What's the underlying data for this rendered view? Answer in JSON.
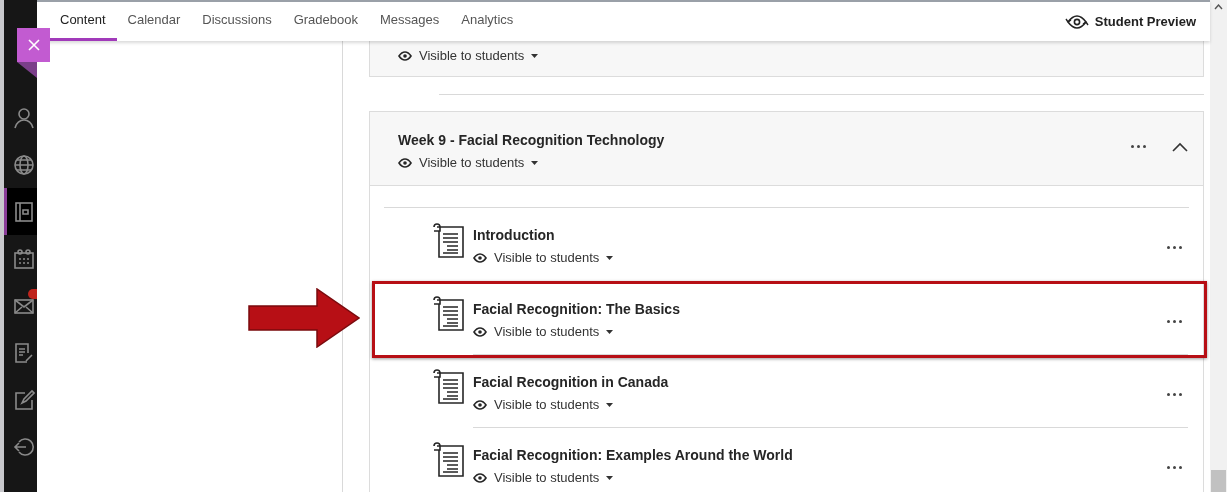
{
  "sidebar": {
    "items": [
      {
        "kind": "profile",
        "selected": false
      },
      {
        "kind": "globe",
        "selected": false
      },
      {
        "kind": "courses",
        "selected": true
      },
      {
        "kind": "calendar",
        "selected": false
      },
      {
        "kind": "messages",
        "selected": false
      },
      {
        "kind": "grades",
        "selected": false
      },
      {
        "kind": "edit",
        "selected": false
      },
      {
        "kind": "signout",
        "selected": false
      }
    ]
  },
  "tabs": [
    {
      "label": "Content",
      "selected": true
    },
    {
      "label": "Calendar",
      "selected": false
    },
    {
      "label": "Discussions",
      "selected": false
    },
    {
      "label": "Gradebook",
      "selected": false
    },
    {
      "label": "Messages",
      "selected": false
    },
    {
      "label": "Analytics",
      "selected": false
    }
  ],
  "student_preview": {
    "label": "Student Preview"
  },
  "sections": [
    {
      "visibility": "Visible to students"
    },
    {
      "title": "Week 9 - Facial Recognition Technology",
      "visibility": "Visible to students",
      "expanded": true,
      "items": [
        {
          "title": "Introduction",
          "visibility": "Visible to students",
          "highlighted": false
        },
        {
          "title": "Facial Recognition: The Basics",
          "visibility": "Visible to students",
          "highlighted": true
        },
        {
          "title": "Facial Recognition in Canada",
          "visibility": "Visible to students",
          "highlighted": false
        },
        {
          "title": "Facial Recognition: Examples Around the World",
          "visibility": "Visible to students",
          "highlighted": false
        }
      ]
    }
  ]
}
